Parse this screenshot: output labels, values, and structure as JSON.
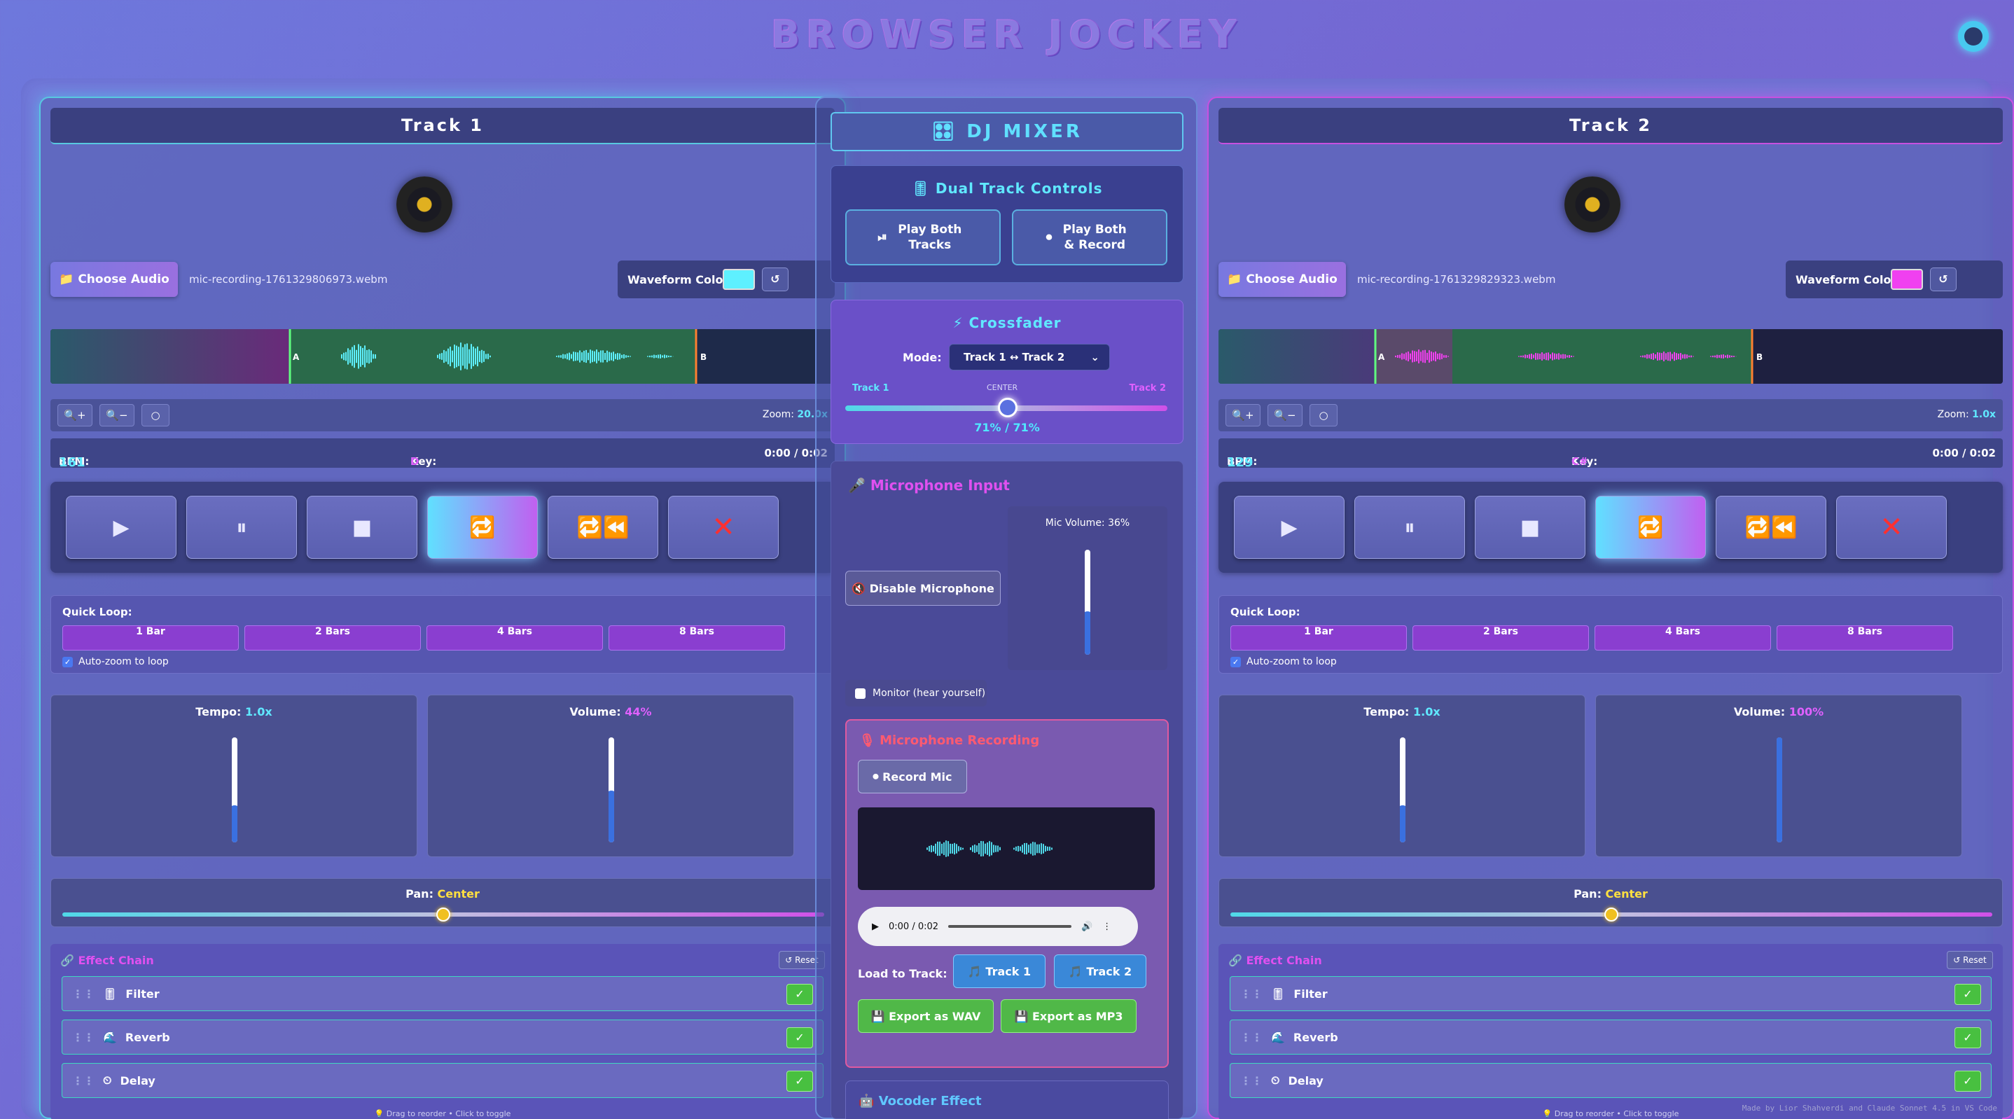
{
  "app": {
    "title": "BROWSER JOCKEY",
    "footer": "Made by Lior Shahverdi and Claude Sonnet 4.5 in VS Code"
  },
  "colors": {
    "track1": "#58c8e0",
    "track2": "#c850e0",
    "accent": "#60e8ff"
  },
  "track1": {
    "title": "Track 1",
    "choose_label": "Choose Audio",
    "filename": "mic-recording-1761329806973.webm",
    "waveform_color_label": "Waveform Color:",
    "waveform_color": "#5ef0ff",
    "reset_glyph": "↺",
    "zoom_label": "Zoom:",
    "zoom_value": "20.0x",
    "bpm_label": "BPM:",
    "bpm": "161",
    "key_label": "Key:",
    "key": "D",
    "time": "0:00 / 0:02",
    "loop_a": "A",
    "loop_b": "B",
    "quick_loop_label": "Quick Loop:",
    "loops": [
      "1 Bar",
      "2 Bars",
      "4 Bars",
      "8 Bars"
    ],
    "auto_zoom_label": "Auto-zoom to loop",
    "tempo_label": "Tempo:",
    "tempo": "1.0x",
    "tempo_level": 0.3,
    "volume_label": "Volume:",
    "volume": "44%",
    "volume_level": 0.44,
    "pan_label": "Pan:",
    "pan": "Center",
    "fx_title": "Effect Chain",
    "fx_reset": "↺ Reset",
    "effects": [
      "Filter",
      "Reverb",
      "Delay"
    ],
    "fx_hint": "Drag to reorder • Click to toggle"
  },
  "track2": {
    "title": "Track 2",
    "choose_label": "Choose Audio",
    "filename": "mic-recording-1761329829323.webm",
    "waveform_color_label": "Waveform Color:",
    "waveform_color": "#f040f0",
    "reset_glyph": "↺",
    "zoom_label": "Zoom:",
    "zoom_value": "1.0x",
    "bpm_label": "BPM:",
    "bpm": "129",
    "key_label": "Key:",
    "key": "C#",
    "time": "0:00 / 0:02",
    "loop_a": "A",
    "loop_b": "B",
    "quick_loop_label": "Quick Loop:",
    "loops": [
      "1 Bar",
      "2 Bars",
      "4 Bars",
      "8 Bars"
    ],
    "auto_zoom_label": "Auto-zoom to loop",
    "tempo_label": "Tempo:",
    "tempo": "1.0x",
    "tempo_level": 0.3,
    "volume_label": "Volume:",
    "volume": "100%",
    "volume_level": 1.0,
    "pan_label": "Pan:",
    "pan": "Center",
    "fx_title": "Effect Chain",
    "fx_reset": "↺ Reset",
    "effects": [
      "Filter",
      "Reverb",
      "Delay"
    ],
    "fx_hint": "Drag to reorder • Click to toggle"
  },
  "mixer": {
    "title": "DJ MIXER",
    "dual_title": "Dual Track Controls",
    "play_both": "Play Both Tracks",
    "play_both_record": "Play Both & Record",
    "crossfader_title": "Crossfader",
    "mode_label": "Mode:",
    "mode_value": "Track 1 ↔ Track 2",
    "xf_left": "Track 1",
    "xf_center": "CENTER",
    "xf_right": "Track 2",
    "xf_readout": "71% / 71%",
    "xf_position": 0.5,
    "mic_title": "Microphone Input",
    "disable_mic": "Disable Microphone",
    "mic_volume_label": "Mic Volume: 36%",
    "mic_volume": 0.36,
    "monitor_label": "Monitor (hear yourself)",
    "rec_title": "Microphone Recording",
    "record_mic": "Record Mic",
    "player_time": "0:00 / 0:02",
    "load_label": "Load to Track:",
    "load_t1": "Track 1",
    "load_t2": "Track 2",
    "export_wav": "Export as WAV",
    "export_mp3": "Export as MP3",
    "vocoder_title": "Vocoder Effect"
  }
}
